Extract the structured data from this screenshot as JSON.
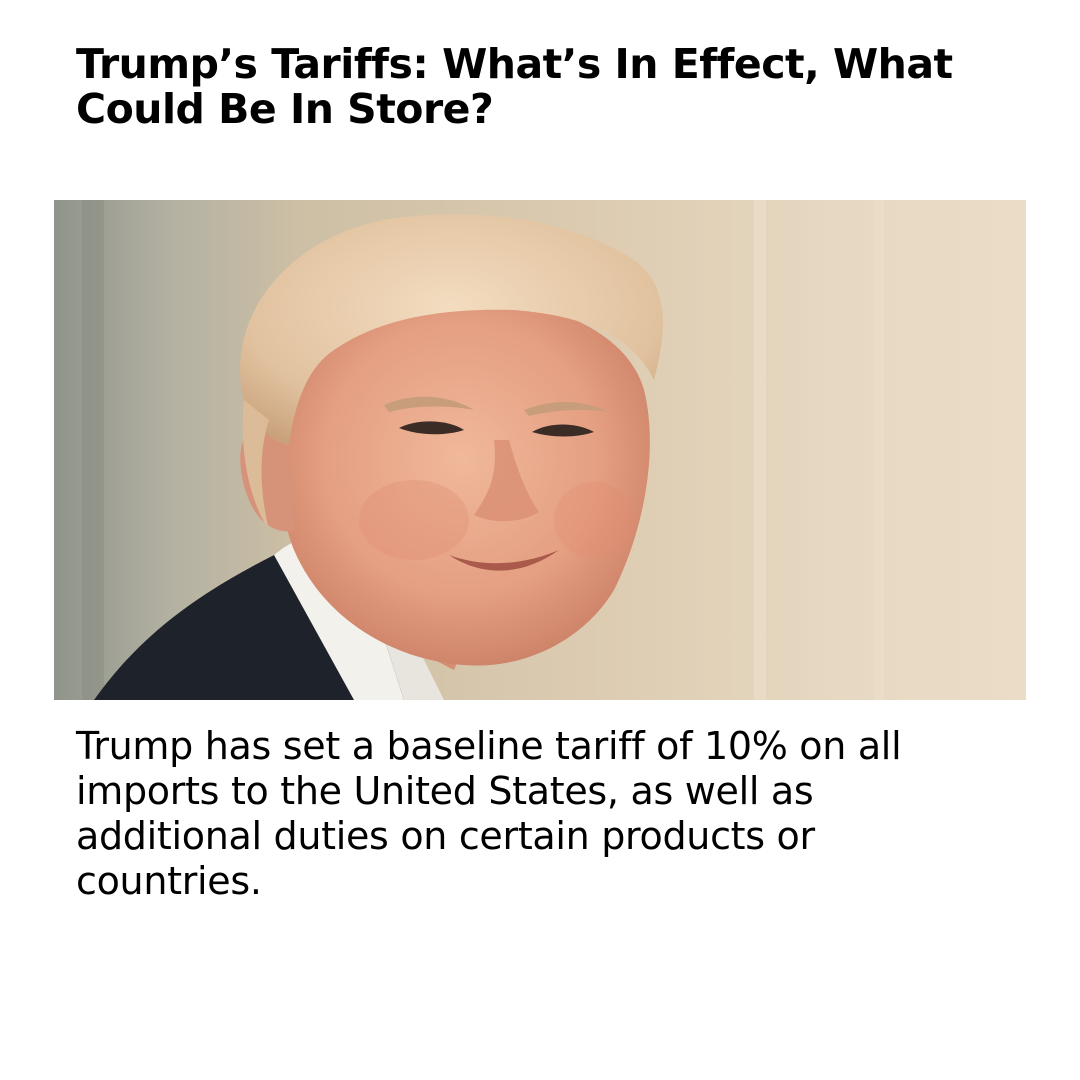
{
  "article": {
    "headline": "Trump’s Tariffs: What’s In Effect, What Could Be In Store?",
    "summary": "Trump has set a baseline tariff of 10% on all imports to the United States, as well as additional duties on certain products or countries."
  },
  "photo": {
    "subject": "portrait-photo"
  }
}
